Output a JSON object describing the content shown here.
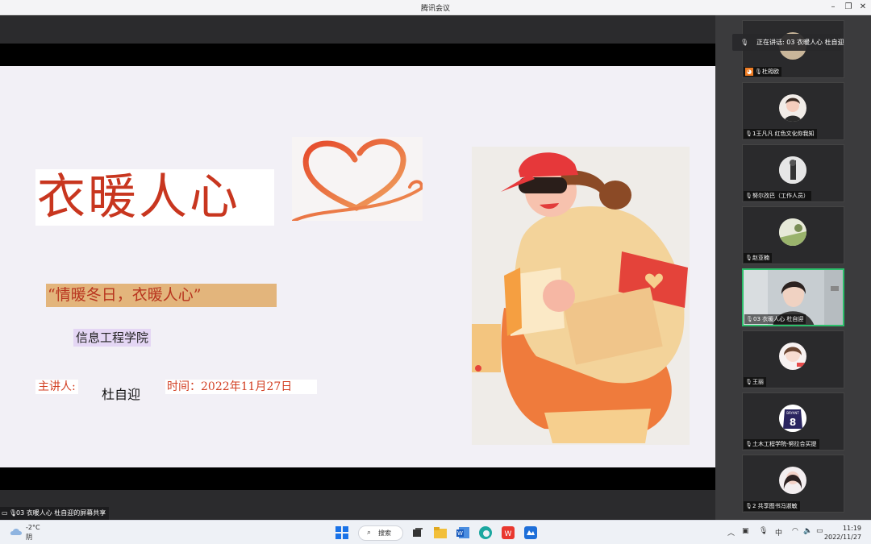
{
  "window": {
    "title": "腾讯会议"
  },
  "slide": {
    "title": "衣暖人心",
    "slogan": "“情暖冬日，衣暖人心”",
    "college": "信息工程学院",
    "speaker_label": "主讲人:",
    "speaker_name": "杜自迎",
    "time_text": "时间：2022年11月27日",
    "colors": {
      "title_red": "#c8361f",
      "slogan_bg": "#e3b57c",
      "college_bg": "#e4d6f4"
    }
  },
  "share_label": "03 衣暖人心 杜自迎的屏幕共享",
  "panel": {
    "speaking_text": "正在讲话: 03 衣暖人心 杜自迎",
    "participants": [
      {
        "name": "杜筠欧",
        "host": true
      },
      {
        "name": "1王凡凡 红色文化你我知"
      },
      {
        "name": "努尔孜巴（工作人员）"
      },
      {
        "name": "赵亚楠"
      },
      {
        "name": "03 衣暖人心 杜自迎",
        "active": true
      },
      {
        "name": "王丽"
      },
      {
        "name": "土木工程学院-努拉合买提"
      },
      {
        "name": "2 共享图书冯淑敏"
      }
    ],
    "tile8_jersey_text": "BRYANT",
    "tile8_jersey_number": "8"
  },
  "taskbar": {
    "temperature": "-2°C",
    "weather": "阴",
    "search_label": "搜索",
    "ime": "中",
    "time": "11:19",
    "date": "2022/11/27"
  }
}
